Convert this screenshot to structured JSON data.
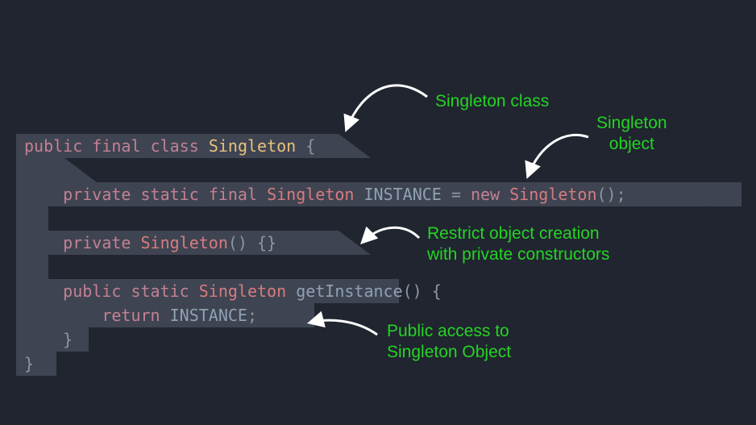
{
  "code": {
    "l1_public": "public",
    "l1_final": "final",
    "l1_class": "class",
    "l1_name": "Singleton",
    "l1_brace": "{",
    "l2_private": "private",
    "l2_static": "static",
    "l2_final": "final",
    "l2_type": "Singleton",
    "l2_instance": "INSTANCE",
    "l2_eq": "=",
    "l2_new": "new",
    "l2_ctor": "Singleton",
    "l2_tail": "();",
    "l3_private": "private",
    "l3_ctor": "Singleton",
    "l3_tail": "() {}",
    "l4_public": "public",
    "l4_static": "static",
    "l4_type": "Singleton",
    "l4_method": "getInstance",
    "l4_tail": "() {",
    "l5_return": "return",
    "l5_instance": "INSTANCE",
    "l5_semi": ";",
    "l6_brace": "}",
    "l7_brace": "}"
  },
  "annotations": {
    "a1": "Singleton class",
    "a2a": "Singleton",
    "a2b": "object",
    "a3a": "Restrict object creation",
    "a3b": "with private constructors",
    "a4a": "Public access to",
    "a4b": "Singleton Object"
  }
}
